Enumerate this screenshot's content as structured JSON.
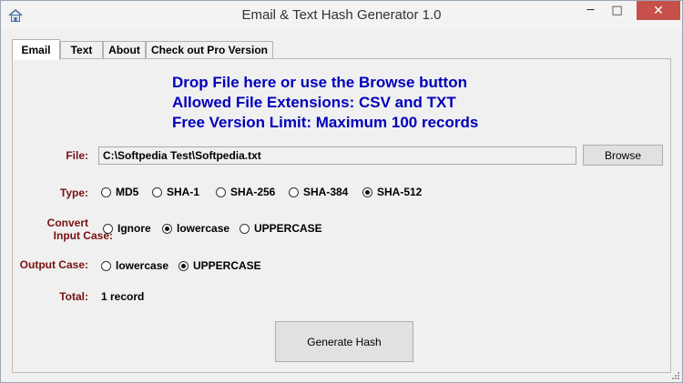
{
  "window": {
    "title": "Email & Text Hash Generator 1.0",
    "controls": {
      "minimize": "─",
      "maximize": "□",
      "close": "✕"
    }
  },
  "tabs": [
    {
      "label": "Email",
      "active": true
    },
    {
      "label": "Text",
      "active": false
    },
    {
      "label": "About",
      "active": false
    },
    {
      "label": "Check out Pro Version",
      "active": false
    }
  ],
  "info": {
    "line1": "Drop File here or use the Browse button",
    "line2": "Allowed File Extensions: CSV and TXT",
    "line3": "Free Version Limit: Maximum 100 records"
  },
  "file": {
    "label": "File:",
    "value": "C:\\Softpedia Test\\Softpedia.txt",
    "browse_label": "Browse"
  },
  "type": {
    "label": "Type:",
    "options": [
      "MD5",
      "SHA-1",
      "SHA-256",
      "SHA-384",
      "SHA-512"
    ],
    "selected": "SHA-512"
  },
  "input_case": {
    "label_line1": "Convert",
    "label_line2": "Input Case:",
    "options": [
      "Ignore",
      "lowercase",
      "UPPERCASE"
    ],
    "selected": "lowercase"
  },
  "output_case": {
    "label": "Output Case:",
    "options": [
      "lowercase",
      "UPPERCASE"
    ],
    "selected": "UPPERCASE"
  },
  "total": {
    "label": "Total:",
    "value": "1 record"
  },
  "generate_label": "Generate Hash",
  "colors": {
    "info_text": "#0000bb",
    "label_text": "#7a1010",
    "close_button": "#c7504a"
  },
  "icons": {
    "app": "house-icon",
    "resize": "resize-grip-icon"
  }
}
